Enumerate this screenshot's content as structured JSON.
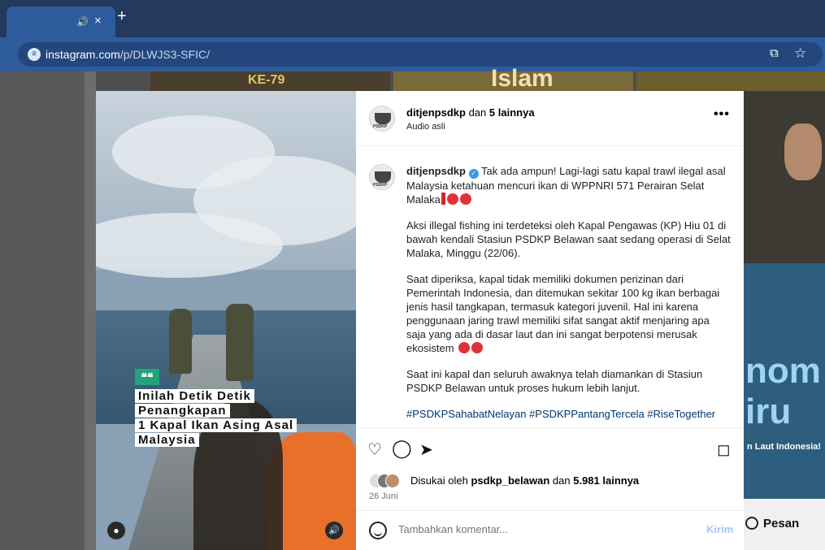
{
  "browser": {
    "tab_audio_icon": "speaker-icon",
    "tab_close": "×",
    "new_tab": "+",
    "url_host": "instagram.com",
    "url_path": "/p/DLWJS3-SFIC/"
  },
  "background": {
    "tile1_text": "KE-79",
    "tile2_text": "Islam",
    "right_big_text": "nom iru",
    "right_small_text": "n Laut Indonesia!",
    "pesan_label": "Pesan"
  },
  "media": {
    "badge": "❝❝",
    "caption_lines": [
      "Inilah Detik Detik",
      "Penangkapan",
      "1 Kapal Ikan Asing Asal",
      "Malaysia"
    ]
  },
  "post": {
    "author": "ditjenpsdkp",
    "collab_joiner": "dan",
    "collab_others": "5 lainnya",
    "audio": "Audio asli",
    "more": "•••",
    "caption_author": "ditjenpsdkp",
    "caption_p1": "Tak ada ampun! Lagi-lagi satu kapal trawl ilegal asal Malaysia ketahuan mencuri ikan di WPPNRI 571 Perairan Selat Malaka",
    "caption_p2": "Aksi illegal fishing ini terdeteksi oleh Kapal Pengawas (KP) Hiu 01 di bawah kendali Stasiun PSDKP Belawan saat sedang operasi di Selat Malaka, Minggu (22/06).",
    "caption_p3": "Saat diperiksa, kapal tidak memiliki dokumen perizinan dari Pemerintah Indonesia, dan ditemukan sekitar 100 kg ikan berbagai jenis hasil tangkapan, termasuk kategori juvenil. Hal ini karena penggunaan jaring trawl memiliki sifat sangat aktif menjaring apa saja yang ada di dasar laut dan ini sangat berpotensi merusak ekosistem",
    "caption_p4": "Saat ini kapal dan seluruh awaknya telah diamankan di Stasiun PSDKP Belawan untuk proses hukum lebih lanjut.",
    "hashtags": "#PSDKPSahabatNelayan #PSDKPPantangTercela #RiseTogether",
    "likes_prefix": "Disukai oleh",
    "likes_user": "psdkp_belawan",
    "likes_joiner": "dan",
    "likes_count": "5.981 lainnya",
    "date": "26 Juni",
    "comment_placeholder": "Tambahkan komentar...",
    "send": "Kirim",
    "verified_color": "#3897f0",
    "link_color": "#00376b"
  }
}
